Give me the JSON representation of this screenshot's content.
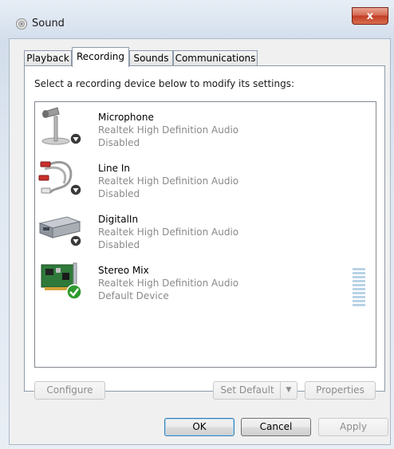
{
  "window": {
    "title": "Sound",
    "close_label": "x"
  },
  "tabs": [
    {
      "label": "Playback",
      "active": false
    },
    {
      "label": "Recording",
      "active": true
    },
    {
      "label": "Sounds",
      "active": false
    },
    {
      "label": "Communications",
      "active": false
    }
  ],
  "instruction": "Select a recording device below to modify its settings:",
  "devices": [
    {
      "name": "Microphone",
      "driver": "Realtek High Definition Audio",
      "status": "Disabled",
      "icon": "microphone-icon",
      "badge": "disabled-arrow"
    },
    {
      "name": "Line In",
      "driver": "Realtek High Definition Audio",
      "status": "Disabled",
      "icon": "line-in-cable-icon",
      "badge": "disabled-arrow"
    },
    {
      "name": "DigitalIn",
      "driver": "Realtek High Definition Audio",
      "status": "Disabled",
      "icon": "digital-in-device-icon",
      "badge": "disabled-arrow"
    },
    {
      "name": "Stereo Mix",
      "driver": "Realtek High Definition Audio",
      "status": "Default Device",
      "icon": "sound-card-icon",
      "badge": "default-checkmark"
    }
  ],
  "buttons": {
    "configure": "Configure",
    "set_default": "Set Default",
    "properties": "Properties",
    "ok": "OK",
    "cancel": "Cancel",
    "apply": "Apply"
  },
  "colors": {
    "default_check": "#2e9b2e",
    "disabled_badge": "#3a3a3a",
    "close_button": "#c9432a"
  }
}
